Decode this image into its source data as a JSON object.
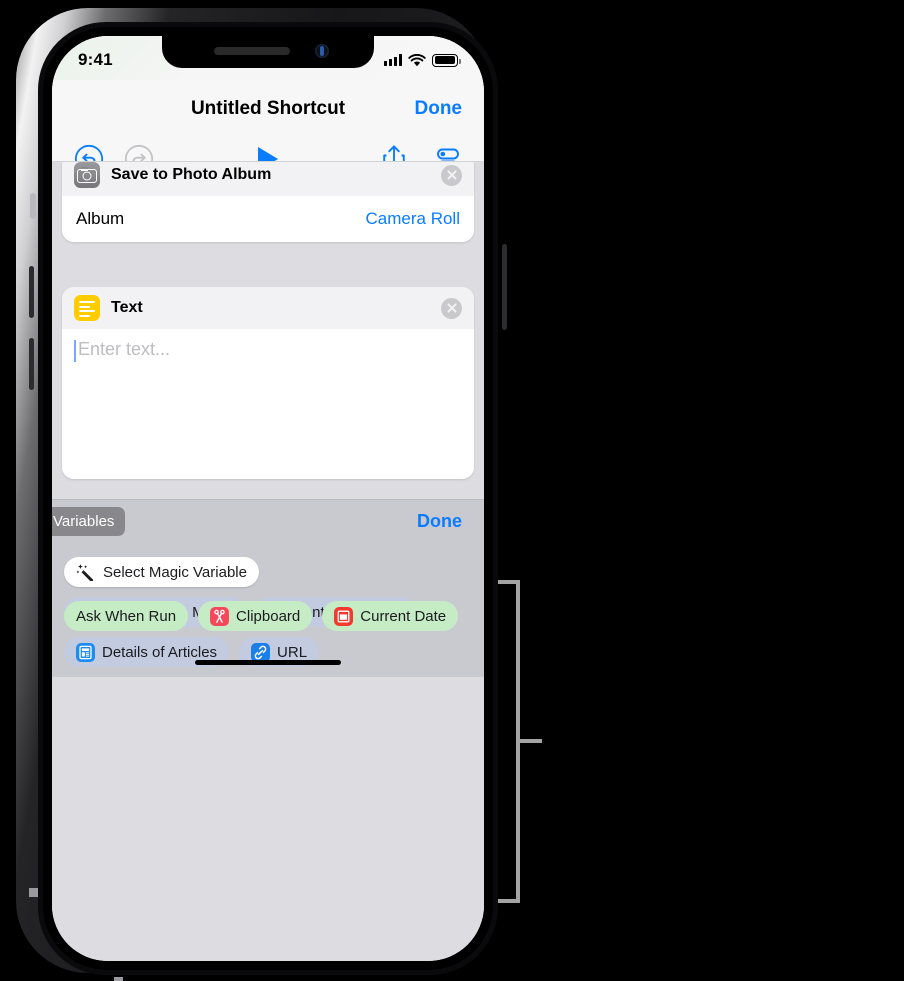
{
  "status_bar": {
    "time": "9:41",
    "cellular_icon": "signal-bars-icon",
    "wifi_icon": "wifi-icon",
    "battery_icon": "battery-icon"
  },
  "navbar": {
    "title": "Untitled Shortcut",
    "done_label": "Done",
    "toolbar": {
      "undo_icon": "undo-icon",
      "redo_icon": "redo-icon",
      "run_icon": "play-icon",
      "share_icon": "share-icon",
      "settings_icon": "settings-toggles-icon"
    }
  },
  "actions": [
    {
      "icon": "camera-icon",
      "title": "Save to Photo Album",
      "remove_label": "×",
      "row_label": "Album",
      "row_value": "Camera Roll"
    },
    {
      "icon": "text-lines-icon",
      "title": "Text",
      "remove_label": "×",
      "placeholder": "Enter text...",
      "value": ""
    }
  ],
  "variables_bar": {
    "label": "Variables",
    "done_label": "Done"
  },
  "variables_panel": {
    "select_magic_variable": {
      "label": "Select Magic Variable",
      "icon": "magic-wand-icon"
    },
    "magic_variables": [
      {
        "label": "Saved Photo Media",
        "icon": "camera-icon"
      },
      {
        "label": "Contents of URL",
        "icon": "download-arrow-icon"
      },
      {
        "label": "Details of Articles",
        "icon": "article-doc-icon"
      },
      {
        "label": "URL",
        "icon": "link-icon"
      }
    ],
    "special_variables": [
      {
        "label": "Ask When Run",
        "icon": ""
      },
      {
        "label": "Clipboard",
        "icon": "scissors-icon"
      },
      {
        "label": "Current Date",
        "icon": "calendar-icon"
      }
    ]
  },
  "colors": {
    "accent_blue": "#0a7cff",
    "panel_grey": "#c9c9d0",
    "background_grey": "#dcdce1",
    "text_yellow": "#ffcc00",
    "green_chip": "#c6ecc6",
    "callout_grey": "#a3a3a3"
  }
}
